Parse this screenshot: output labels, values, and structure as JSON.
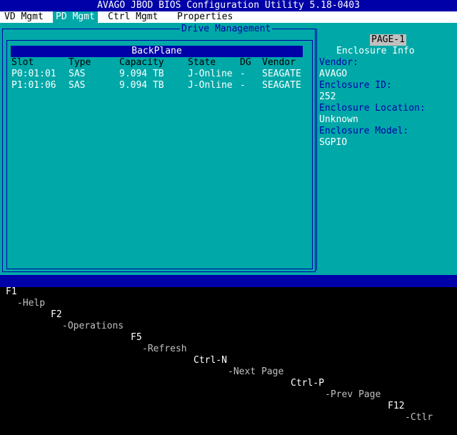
{
  "title": "AVAGO JBOD BIOS Configuration Utility 5.18-0403",
  "menu": [
    {
      "label": "VD Mgmt"
    },
    {
      "label": "PD Mgmt"
    },
    {
      "label": "Ctrl Mgmt"
    },
    {
      "label": "Properties"
    }
  ],
  "frame_title": "Drive Management",
  "backplane_label": "BackPlane",
  "columns": [
    "Slot",
    "Type",
    "Capacity",
    "State",
    "DG",
    "Vendor"
  ],
  "drives": [
    {
      "slot": "P0:01:01",
      "type": "SAS",
      "capacity": "9.094 TB",
      "state": "J-Online",
      "dg": "-",
      "vendor": "SEAGATE"
    },
    {
      "slot": "P1:01:06",
      "type": "SAS",
      "capacity": "9.094 TB",
      "state": "J-Online",
      "dg": "-",
      "vendor": "SEAGATE"
    }
  ],
  "info": {
    "page": "PAGE-1",
    "heading": "Enclosure Info",
    "vendor_label": "Vendor:",
    "vendor_value": "AVAGO",
    "id_label": "Enclosure ID:",
    "id_value": "252",
    "location_label": "Enclosure Location:",
    "location_value": "Unknown",
    "model_label": "Enclosure Model:",
    "model_value": "SGPIO"
  },
  "help": [
    {
      "key": "F1",
      "desc": "-Help"
    },
    {
      "key": "F2",
      "desc": "-Operations"
    },
    {
      "key": "F5",
      "desc": "-Refresh"
    },
    {
      "key": "Ctrl-N",
      "desc": "-Next Page"
    },
    {
      "key": "Ctrl-P",
      "desc": "-Prev Page"
    },
    {
      "key": "F12",
      "desc": "-Ctlr"
    }
  ],
  "colors": {
    "background": "#00a8a8",
    "accent": "#0000a8",
    "menu_bg": "#ffffff"
  }
}
